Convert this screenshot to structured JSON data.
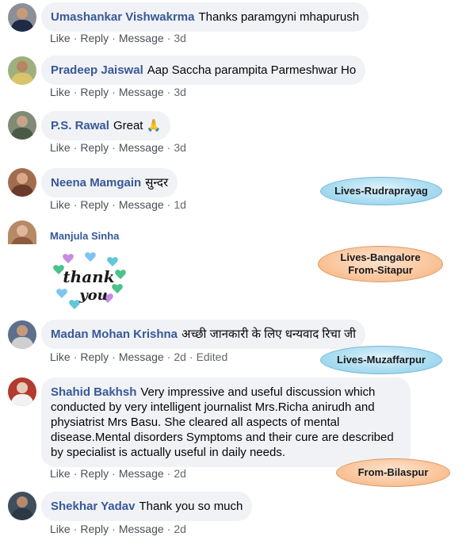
{
  "comments": [
    {
      "author": "Umashankar Vishwakrma",
      "text": "Thanks paramgyni mhapurush",
      "actions": [
        "Like",
        "Reply",
        "Message",
        "3d"
      ]
    },
    {
      "author": "Pradeep Jaiswal",
      "text": "Aap Saccha parampita Parmeshwar Ho",
      "actions": [
        "Like",
        "Reply",
        "Message",
        "3d"
      ]
    },
    {
      "author": "P.S. Rawal",
      "text": "Great 🙏",
      "actions": [
        "Like",
        "Reply",
        "Message",
        "3d"
      ]
    },
    {
      "author": "Neena Mamgain",
      "text": "सुन्दर",
      "actions": [
        "Like",
        "Reply",
        "Message",
        "1d"
      ]
    },
    {
      "author": "Manjula Sinha",
      "sticker_text": "thank you"
    },
    {
      "author": "Madan Mohan Krishna",
      "text": "अच्छी जानकारी के लिए धन्यवाद रिचा जी",
      "actions": [
        "Like",
        "Reply",
        "Message",
        "2d",
        "Edited"
      ]
    },
    {
      "author": "Shahid Bakhsh",
      "text": "Very impressive and useful discussion which conducted by very intelligent journalist Mrs.Richa anirudh and physiatrist Mrs Basu. She cleared all aspects of mental disease.Mental disorders Symptoms and their cure are described by specialist is actually useful in daily needs.",
      "actions": [
        "Like",
        "Reply",
        "Message",
        "2d"
      ]
    },
    {
      "author": "Shekhar Yadav",
      "text": "Thank you so much",
      "actions": [
        "Like",
        "Reply",
        "Message",
        "2d"
      ]
    }
  ],
  "tags": [
    {
      "line1": "Lives-Rudraprayag",
      "line2": ""
    },
    {
      "line1": "Lives-Bangalore",
      "line2": "From-Sitapur"
    },
    {
      "line1": "Lives-Muzaffarpur",
      "line2": ""
    },
    {
      "line1": "From-Bilaspur",
      "line2": ""
    }
  ],
  "colors": {
    "author": "#385898",
    "bubble": "#f0f2f5",
    "tag_blue": "#9fd8ef",
    "tag_orange": "#f9c093"
  }
}
